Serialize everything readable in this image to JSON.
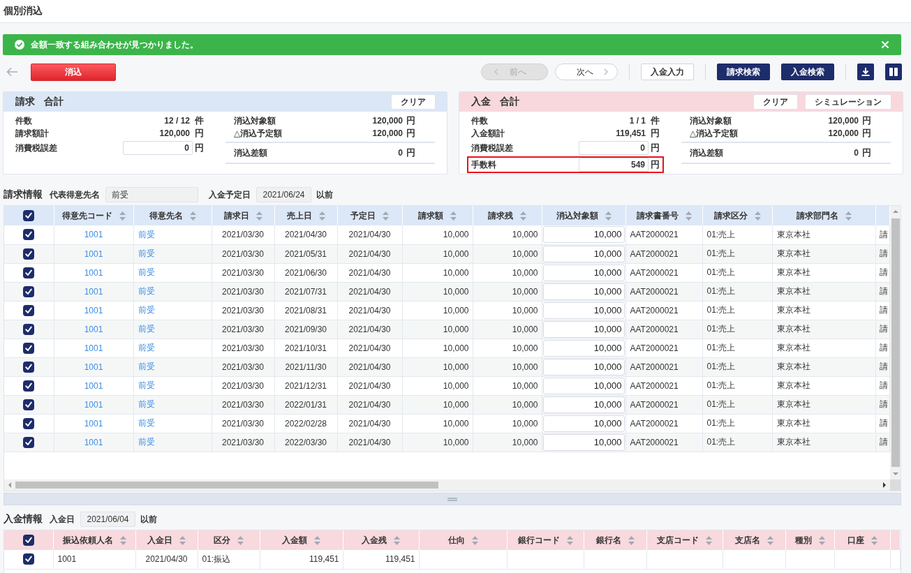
{
  "page_title": "個別消込",
  "alert": {
    "message": "金額一致する組み合わせが見つかりました。"
  },
  "toolbar": {
    "reconcile_button": "消込",
    "pager": [
      {
        "kind": "prev",
        "label": "前へ",
        "disabled": true
      },
      {
        "kind": "next",
        "label": "次へ",
        "disabled": false
      }
    ],
    "actions": [
      {
        "kind": "plain",
        "label": "入金入力"
      },
      {
        "kind": "primary",
        "label": "請求検索"
      },
      {
        "kind": "primary",
        "label": "入金検索"
      }
    ]
  },
  "summaries": [
    {
      "kind": "billing",
      "title": "請求",
      "subtitle": "合計",
      "buttons": [
        "クリア"
      ],
      "rows_left": [
        {
          "kind": "text",
          "label": "件数",
          "value": "12 / 12",
          "unit": "件",
          "highlighted": false
        },
        {
          "kind": "text",
          "label": "請求額計",
          "value": "120,000",
          "unit": "円",
          "highlighted": false
        },
        {
          "kind": "input",
          "label": "消費税誤差",
          "value": "0",
          "unit": "円",
          "highlighted": false
        }
      ],
      "rows_right": [
        {
          "kind": "text",
          "label": "消込対象額",
          "value": "120,000",
          "unit": "円"
        },
        {
          "kind": "text",
          "label": "△消込予定額",
          "value": "120,000",
          "unit": "円"
        },
        {
          "kind": "total",
          "label": "消込差額",
          "value": "0",
          "unit": "円"
        }
      ]
    },
    {
      "kind": "payment",
      "title": "入金",
      "subtitle": "合計",
      "buttons": [
        "クリア",
        "シミュレーション"
      ],
      "rows_left": [
        {
          "kind": "text",
          "label": "件数",
          "value": "1 / 1",
          "unit": "件",
          "highlighted": false
        },
        {
          "kind": "text",
          "label": "入金額計",
          "value": "119,451",
          "unit": "円",
          "highlighted": false
        },
        {
          "kind": "input",
          "label": "消費税誤差",
          "value": "0",
          "unit": "円",
          "highlighted": false
        },
        {
          "kind": "input",
          "label": "手数料",
          "value": "549",
          "unit": "円",
          "highlighted": true
        }
      ],
      "rows_right": [
        {
          "kind": "text",
          "label": "消込対象額",
          "value": "120,000",
          "unit": "円"
        },
        {
          "kind": "text",
          "label": "△消込予定額",
          "value": "120,000",
          "unit": "円"
        },
        {
          "kind": "total",
          "label": "消込差額",
          "value": "0",
          "unit": "円"
        }
      ]
    }
  ],
  "sections": [
    {
      "kind": "billing",
      "title": "請求情報",
      "filters": [
        {
          "kind": "text",
          "label": "代表得意先名",
          "value": "前受"
        },
        {
          "kind": "date",
          "label": "入金予定日",
          "value": "2021/06/24",
          "suffix": "以前"
        }
      ],
      "table": {
        "all_checked": true,
        "columns": [
          {
            "label": "得意先コード",
            "kind": "code"
          },
          {
            "label": "得意先名",
            "kind": "link"
          },
          {
            "label": "請求日",
            "kind": "date"
          },
          {
            "label": "売上日",
            "kind": "date"
          },
          {
            "label": "予定日",
            "kind": "date"
          },
          {
            "label": "請求額",
            "kind": "number"
          },
          {
            "label": "請求残",
            "kind": "number"
          },
          {
            "label": "消込対象額",
            "kind": "input"
          },
          {
            "label": "請求書番号",
            "kind": "text"
          },
          {
            "label": "請求区分",
            "kind": "text"
          },
          {
            "label": "請求部門名",
            "kind": "text"
          },
          {
            "kind": "text"
          }
        ],
        "rows": [
          {
            "checked": true,
            "cells": [
              "1001",
              "前受",
              "2021/03/30",
              "2021/04/30",
              "2021/04/30",
              "10,000",
              "10,000",
              "10,000",
              "AAT2000021",
              "01:売上",
              "東京本社",
              "請"
            ]
          },
          {
            "checked": true,
            "cells": [
              "1001",
              "前受",
              "2021/03/30",
              "2021/05/31",
              "2021/04/30",
              "10,000",
              "10,000",
              "10,000",
              "AAT2000021",
              "01:売上",
              "東京本社",
              "請"
            ]
          },
          {
            "checked": true,
            "cells": [
              "1001",
              "前受",
              "2021/03/30",
              "2021/06/30",
              "2021/04/30",
              "10,000",
              "10,000",
              "10,000",
              "AAT2000021",
              "01:売上",
              "東京本社",
              "請"
            ]
          },
          {
            "checked": true,
            "cells": [
              "1001",
              "前受",
              "2021/03/30",
              "2021/07/31",
              "2021/04/30",
              "10,000",
              "10,000",
              "10,000",
              "AAT2000021",
              "01:売上",
              "東京本社",
              "請"
            ]
          },
          {
            "checked": true,
            "cells": [
              "1001",
              "前受",
              "2021/03/30",
              "2021/08/31",
              "2021/04/30",
              "10,000",
              "10,000",
              "10,000",
              "AAT2000021",
              "01:売上",
              "東京本社",
              "請"
            ]
          },
          {
            "checked": true,
            "cells": [
              "1001",
              "前受",
              "2021/03/30",
              "2021/09/30",
              "2021/04/30",
              "10,000",
              "10,000",
              "10,000",
              "AAT2000021",
              "01:売上",
              "東京本社",
              "請"
            ]
          },
          {
            "checked": true,
            "cells": [
              "1001",
              "前受",
              "2021/03/30",
              "2021/10/31",
              "2021/04/30",
              "10,000",
              "10,000",
              "10,000",
              "AAT2000021",
              "01:売上",
              "東京本社",
              "請"
            ]
          },
          {
            "checked": true,
            "cells": [
              "1001",
              "前受",
              "2021/03/30",
              "2021/11/30",
              "2021/04/30",
              "10,000",
              "10,000",
              "10,000",
              "AAT2000021",
              "01:売上",
              "東京本社",
              "請"
            ]
          },
          {
            "checked": true,
            "cells": [
              "1001",
              "前受",
              "2021/03/30",
              "2021/12/31",
              "2021/04/30",
              "10,000",
              "10,000",
              "10,000",
              "AAT2000021",
              "01:売上",
              "東京本社",
              "請"
            ]
          },
          {
            "checked": true,
            "cells": [
              "1001",
              "前受",
              "2021/03/30",
              "2022/01/31",
              "2021/04/30",
              "10,000",
              "10,000",
              "10,000",
              "AAT2000021",
              "01:売上",
              "東京本社",
              "請"
            ]
          },
          {
            "checked": true,
            "cells": [
              "1001",
              "前受",
              "2021/03/30",
              "2022/02/28",
              "2021/04/30",
              "10,000",
              "10,000",
              "10,000",
              "AAT2000021",
              "01:売上",
              "東京本社",
              "請"
            ]
          },
          {
            "checked": true,
            "cells": [
              "1001",
              "前受",
              "2021/03/30",
              "2022/03/30",
              "2021/04/30",
              "10,000",
              "10,000",
              "10,000",
              "AAT2000021",
              "01:売上",
              "東京本社",
              "請"
            ]
          }
        ]
      }
    },
    {
      "kind": "payment",
      "title": "入金情報",
      "filters": [
        {
          "kind": "date",
          "label": "入金日",
          "value": "2021/06/04",
          "suffix": "以前"
        }
      ],
      "table": {
        "all_checked": true,
        "columns": [
          {
            "label": "振込依頼人名",
            "kind": "text"
          },
          {
            "label": "入金日",
            "kind": "date"
          },
          {
            "label": "区分",
            "kind": "text"
          },
          {
            "label": "入金額",
            "kind": "number"
          },
          {
            "label": "入金残",
            "kind": "number"
          },
          {
            "label": "仕向",
            "kind": "text"
          },
          {
            "label": "銀行コード",
            "kind": "text"
          },
          {
            "label": "銀行名",
            "kind": "text"
          },
          {
            "label": "支店コード",
            "kind": "text"
          },
          {
            "label": "支店名",
            "kind": "text"
          },
          {
            "label": "種別",
            "kind": "text"
          },
          {
            "label": "口座",
            "kind": "text"
          }
        ],
        "rows": [
          {
            "checked": true,
            "cells": [
              "1001",
              "2021/04/30",
              "01:振込",
              "119,451",
              "119,451"
            ]
          }
        ]
      }
    }
  ]
}
